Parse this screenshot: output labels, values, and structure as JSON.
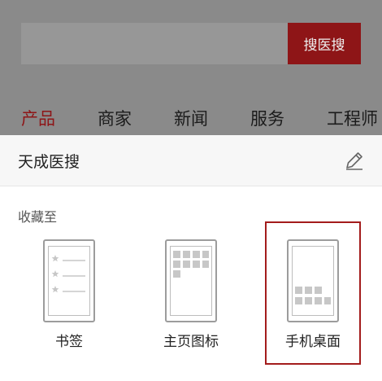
{
  "search": {
    "input_value": "",
    "button_label": "搜医搜"
  },
  "tabs": [
    {
      "label": "产品",
      "active": true
    },
    {
      "label": "商家",
      "active": false
    },
    {
      "label": "新闻",
      "active": false
    },
    {
      "label": "服务",
      "active": false
    },
    {
      "label": "工程师",
      "active": false
    }
  ],
  "sheet": {
    "title": "天成医搜",
    "section_label": "收藏至",
    "options": [
      {
        "label": "书签",
        "icon": "bookmark-list-icon",
        "selected": false
      },
      {
        "label": "主页图标",
        "icon": "home-grid-icon",
        "selected": false
      },
      {
        "label": "手机桌面",
        "icon": "phone-desktop-icon",
        "selected": true
      }
    ]
  },
  "colors": {
    "accent": "#8e1517",
    "overlay": "#8a8a8a",
    "selected_outline": "#a31c1c"
  }
}
